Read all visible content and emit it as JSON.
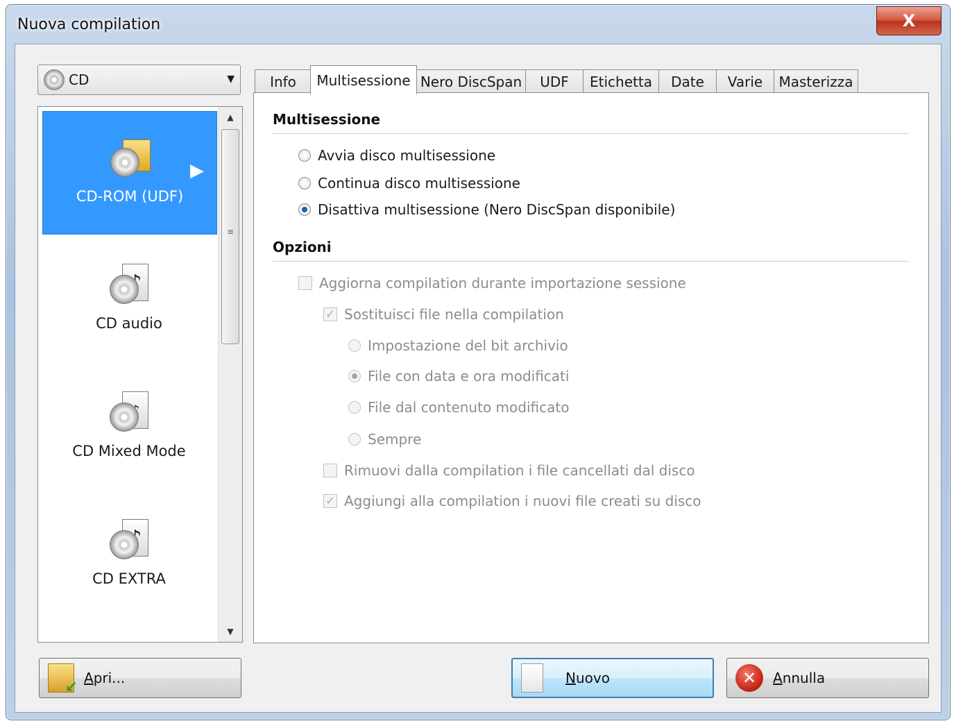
{
  "window": {
    "title": "Nuova compilation",
    "close_glyph": "X"
  },
  "left": {
    "media_select": {
      "value": "CD"
    },
    "items": [
      {
        "label": "CD-ROM (UDF)",
        "selected": true,
        "icon": "cd-rom-udf-icon"
      },
      {
        "label": "CD audio",
        "selected": false,
        "icon": "cd-audio-icon"
      },
      {
        "label": "CD Mixed Mode",
        "selected": false,
        "icon": "cd-mixed-mode-icon"
      },
      {
        "label": "CD EXTRA",
        "selected": false,
        "icon": "cd-extra-icon"
      }
    ]
  },
  "tabs": [
    {
      "label": "Info"
    },
    {
      "label": "Multisessione",
      "active": true
    },
    {
      "label": "Nero DiscSpan"
    },
    {
      "label": "UDF"
    },
    {
      "label": "Etichetta"
    },
    {
      "label": "Date"
    },
    {
      "label": "Varie"
    },
    {
      "label": "Masterizza"
    }
  ],
  "panel": {
    "multisession": {
      "title": "Multisessione",
      "options": [
        {
          "label": "Avvia disco multisessione",
          "checked": false
        },
        {
          "label": "Continua disco multisessione",
          "checked": false
        },
        {
          "label": "Disattiva multisessione (Nero DiscSpan disponibile)",
          "checked": true
        }
      ]
    },
    "options": {
      "title": "Opzioni",
      "update_compilation": "Aggiorna compilation durante importazione sessione",
      "replace_files": "Sostituisci file nella compilation",
      "archive_bit": "Impostazione del bit archivio",
      "date_time_modified": "File con data e ora modificati",
      "content_modified": "File dal contenuto modificato",
      "always": "Sempre",
      "remove_deleted": "Rimuovi dalla compilation i file cancellati dal disco",
      "add_new": "Aggiungi alla compilation i nuovi file creati su disco",
      "check_glyph": "✓"
    }
  },
  "buttons": {
    "open": {
      "accel": "A",
      "rest": "pri..."
    },
    "new": {
      "accel": "N",
      "rest": "uovo"
    },
    "cancel": {
      "accel": "A",
      "rest": "nnulla"
    },
    "cancel_glyph": "✕"
  },
  "colors": {
    "selection": "#3399ff",
    "default_button_border": "#3c7fb1",
    "close_button": "#c9402a"
  }
}
